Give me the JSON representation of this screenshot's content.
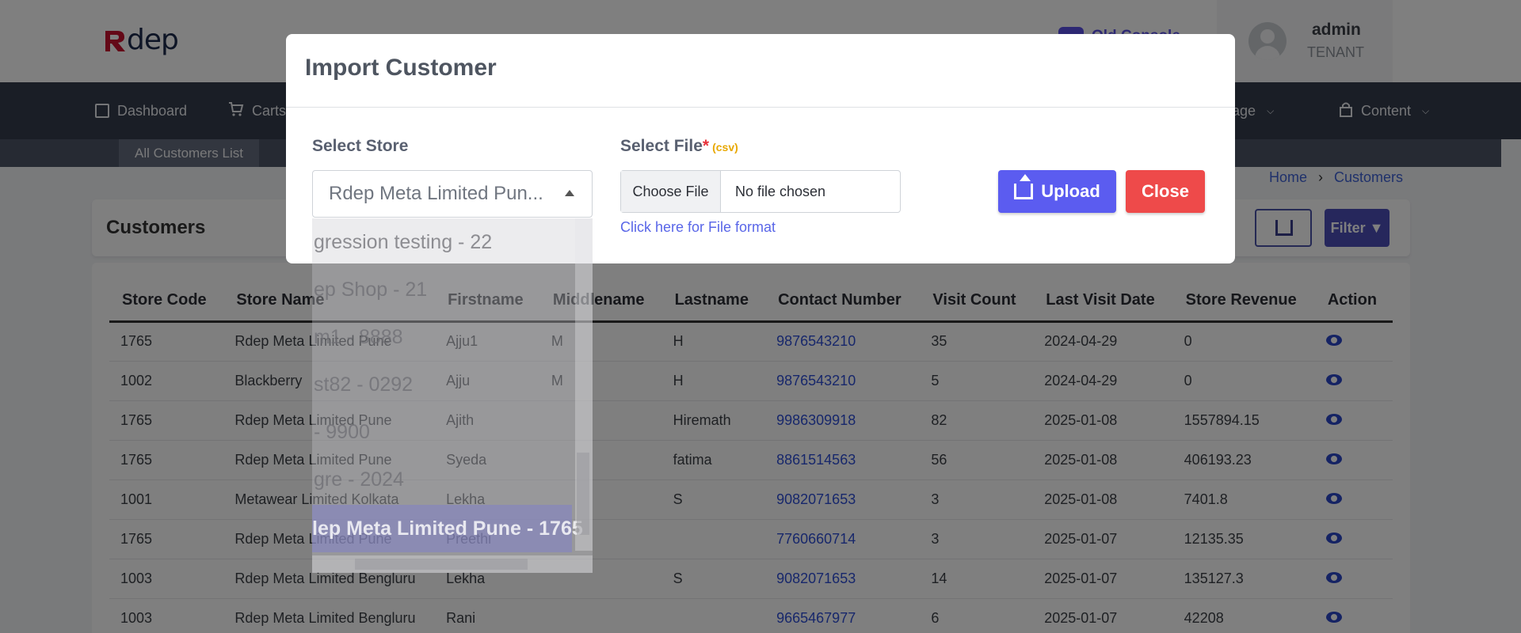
{
  "brand": {
    "logo_text": "dep"
  },
  "header": {
    "toggle_label": "Old Console",
    "user_name": "admin",
    "user_role": "TENANT"
  },
  "nav": {
    "items": [
      {
        "label": "Dashboard",
        "icon": "grid-icon"
      },
      {
        "label": "Carts",
        "icon": "cart-icon"
      },
      {
        "label": "Manage",
        "icon": "manage-icon"
      },
      {
        "label": "Content",
        "icon": "lock-icon"
      }
    ],
    "subnav_label": "All Customers List"
  },
  "breadcrumb": {
    "home": "Home",
    "current": "Customers"
  },
  "page": {
    "title": "Customers",
    "filter_label": "Filter"
  },
  "table": {
    "columns": [
      "Store Code",
      "Store Name",
      "Firstname",
      "Middlename",
      "Lastname",
      "Contact Number",
      "Visit Count",
      "Last Visit Date",
      "Store Revenue",
      "Action"
    ],
    "rows": [
      [
        "1765",
        "Rdep Meta Limited Pune",
        "Ajju1",
        "M",
        "H",
        "9876543210",
        "35",
        "2024-04-29",
        "0"
      ],
      [
        "1002",
        "Blackberry",
        "Ajju",
        "M",
        "H",
        "9876543210",
        "5",
        "2024-04-29",
        "0"
      ],
      [
        "1765",
        "Rdep Meta Limited Pune",
        "Ajith",
        "",
        "Hiremath",
        "9986309918",
        "82",
        "2025-01-08",
        "1557894.15"
      ],
      [
        "1765",
        "Rdep Meta Limited Pune",
        "Syeda",
        "",
        "fatima",
        "8861514563",
        "56",
        "2025-01-08",
        "406193.23"
      ],
      [
        "1001",
        "Metawear Limited Kolkata",
        "Lekha",
        "",
        "S",
        "9082071653",
        "3",
        "2025-01-08",
        "7401.8"
      ],
      [
        "1765",
        "Rdep Meta Limited Pune",
        "Preethi",
        "",
        "",
        "7760660714",
        "3",
        "2025-01-07",
        "12135.35"
      ],
      [
        "1003",
        "Rdep Meta Limited Bengluru",
        "Lekha",
        "",
        "S",
        "9082071653",
        "14",
        "2025-01-07",
        "135127.3"
      ],
      [
        "1003",
        "Rdep Meta Limited Bengluru",
        "Rani",
        "",
        "",
        "9665467977",
        "6",
        "2025-01-07",
        "42208"
      ]
    ]
  },
  "modal": {
    "title": "Import Customer",
    "store_label": "Select Store",
    "store_value": "Rdep Meta Limited Pun...",
    "file_label": "Select File",
    "file_required": "*",
    "file_hint": "(csv)",
    "choose_file": "Choose File",
    "no_file": "No file chosen",
    "format_link": "Click here for File format",
    "upload_label": "Upload",
    "close_label": "Close",
    "dropdown_items": [
      "gression testing - 22",
      "ep Shop - 21",
      "m1 - 8888",
      "st82 - 0292",
      "- 9900",
      "gre - 2024",
      "lep Meta Limited Pune - 1765"
    ]
  }
}
